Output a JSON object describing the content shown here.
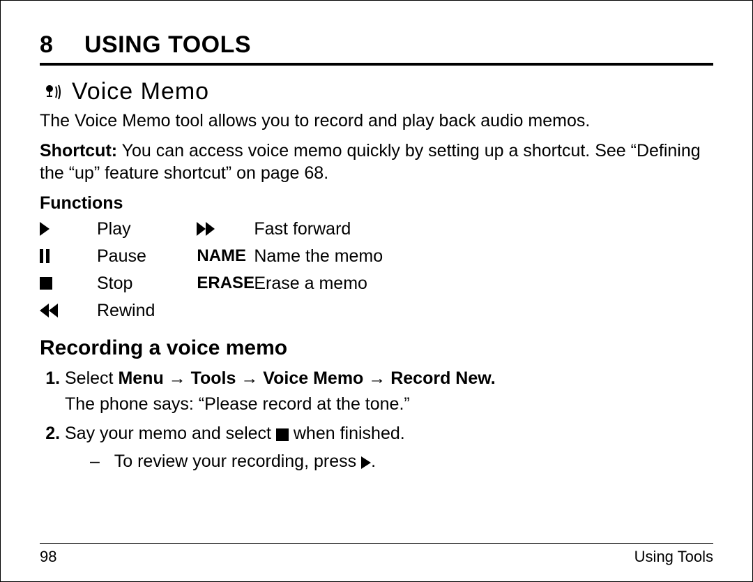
{
  "chapter": {
    "number": "8",
    "title": "USING TOOLS"
  },
  "section": {
    "heading": "Voice Memo",
    "intro": "The Voice Memo tool allows you to record and play back audio memos.",
    "shortcut_label": "Shortcut:",
    "shortcut_text": " You can access voice memo quickly by setting up a shortcut. See “Defining the “up” feature shortcut” on page 68."
  },
  "functions": {
    "heading": "Functions",
    "left": [
      {
        "icon": "play",
        "label": "Play"
      },
      {
        "icon": "pause",
        "label": "Pause"
      },
      {
        "icon": "stop",
        "label": "Stop"
      },
      {
        "icon": "rewind",
        "label": "Rewind"
      }
    ],
    "right": [
      {
        "icon": "fastforward",
        "label": "Fast forward"
      },
      {
        "icon_text": "NAME",
        "label": "Name the memo"
      },
      {
        "icon_text": "ERASE",
        "label": "Erase a memo"
      }
    ]
  },
  "recording": {
    "heading": "Recording a voice memo",
    "step1_prefix": "Select ",
    "step1_path": "Menu → Tools → Voice Memo → Record New.",
    "step1_line2": "The phone says: “Please record at the tone.”",
    "step2_text_before": "Say your memo and select ",
    "step2_text_after": " when finished.",
    "step2_sub_before": "–   To review your recording, press ",
    "step2_sub_after": "."
  },
  "footer": {
    "page_number": "98",
    "section": "Using Tools"
  }
}
